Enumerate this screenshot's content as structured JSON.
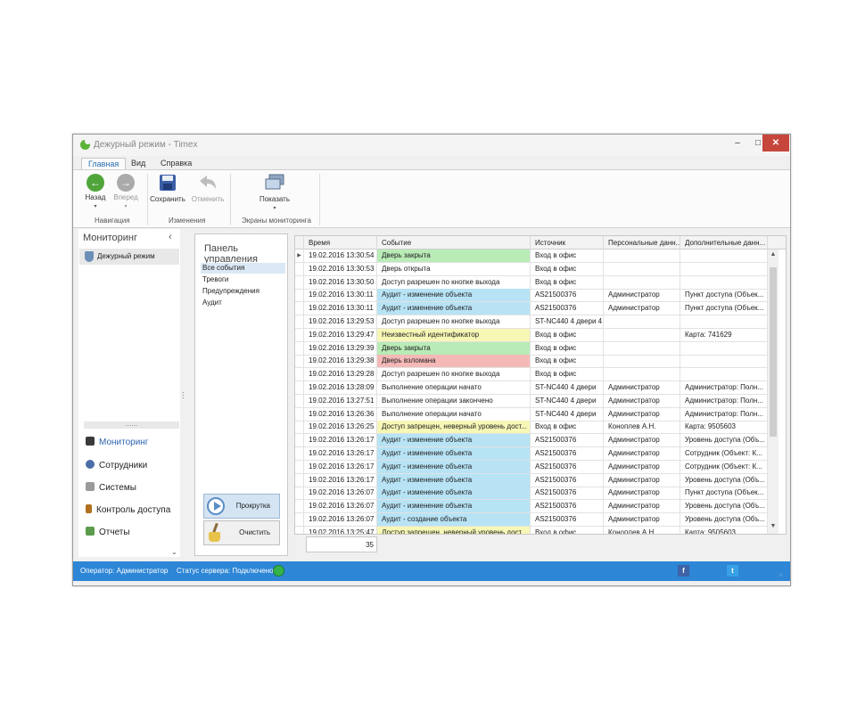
{
  "window": {
    "title": "Дежурный режим - Timex"
  },
  "menu": {
    "items": [
      "Главная",
      "Вид",
      "Справка"
    ]
  },
  "ribbon": {
    "back": "Назад",
    "forward": "Вперед",
    "save": "Сохранить",
    "undo": "Отменить",
    "show": "Показать",
    "groups": {
      "navigation": "Навигация",
      "changes": "Изменения",
      "screens": "Экраны мониторинга"
    }
  },
  "left_panel": {
    "title": "Мониторинг",
    "selected_item": "Дежурный режим",
    "nav": [
      {
        "label": "Мониторинг",
        "icon": "monitor-icon",
        "color": "#3a3a3a"
      },
      {
        "label": "Сотрудники",
        "icon": "employees-icon",
        "color": "#4a6ea8"
      },
      {
        "label": "Системы",
        "icon": "systems-icon",
        "color": "#9a9a9a"
      },
      {
        "label": "Контроль доступа",
        "icon": "door-icon",
        "color": "#b0701f"
      },
      {
        "label": "Отчеты",
        "icon": "reports-icon",
        "color": "#5c9b4c"
      }
    ]
  },
  "control_panel": {
    "title": "Панель управления",
    "items": [
      "Все события",
      "Тревоги",
      "Предупреждения",
      "Аудит"
    ],
    "scroll_button": "Прокрутка",
    "clear_button": "Очистить"
  },
  "grid": {
    "columns": [
      "Время",
      "Событие",
      "Источник",
      "Персональные данн...",
      "Дополнительные данн..."
    ],
    "rows": [
      {
        "time": "19.02.2016 13:30:54",
        "event": "Дверь закрыта",
        "source": "Вход в офис",
        "personal": "",
        "extra": "",
        "color": "#b9ebb7"
      },
      {
        "time": "19.02.2016 13:30:53",
        "event": "Дверь открыта",
        "source": "Вход в офис",
        "personal": "",
        "extra": "",
        "color": ""
      },
      {
        "time": "19.02.2016 13:30:50",
        "event": "Доступ разрешен по кнопке выхода",
        "source": "Вход в офис",
        "personal": "",
        "extra": "",
        "color": ""
      },
      {
        "time": "19.02.2016 13:30:11",
        "event": "Аудит - изменение объекта",
        "source": "AS21500376",
        "personal": "Администратор",
        "extra": "Пункт доступа (Объек...",
        "color": "#b7e3f5"
      },
      {
        "time": "19.02.2016 13:30:11",
        "event": "Аудит - изменение объекта",
        "source": "AS21500376",
        "personal": "Администратор",
        "extra": "Пункт доступа (Объек...",
        "color": "#b7e3f5"
      },
      {
        "time": "19.02.2016 13:29:53",
        "event": "Доступ разрешен по кнопке выхода",
        "source": "ST-NC440 4 двери 4",
        "personal": "",
        "extra": "",
        "color": ""
      },
      {
        "time": "19.02.2016 13:29:47",
        "event": "Неизвестный идентификатор",
        "source": "Вход в офис",
        "personal": "",
        "extra": "Карта: 741629",
        "color": "#f7f7b6"
      },
      {
        "time": "19.02.2016 13:29:39",
        "event": "Дверь закрыта",
        "source": "Вход в офис",
        "personal": "",
        "extra": "",
        "color": "#b9ebb7"
      },
      {
        "time": "19.02.2016 13:29:38",
        "event": "Дверь взломана",
        "source": "Вход в офис",
        "personal": "",
        "extra": "",
        "color": "#f4b9b7"
      },
      {
        "time": "19.02.2016 13:29:28",
        "event": "Доступ разрешен по кнопке выхода",
        "source": "Вход в офис",
        "personal": "",
        "extra": "",
        "color": ""
      },
      {
        "time": "19.02.2016 13:28:09",
        "event": "Выполнение операции начато",
        "source": "ST-NC440 4 двери",
        "personal": "Администратор",
        "extra": "Администратор: Полн...",
        "color": ""
      },
      {
        "time": "19.02.2016 13:27:51",
        "event": "Выполнение операции закончено",
        "source": "ST-NC440 4 двери",
        "personal": "Администратор",
        "extra": "Администратор: Полн...",
        "color": ""
      },
      {
        "time": "19.02.2016 13:26:36",
        "event": "Выполнение операции начато",
        "source": "ST-NC440 4 двери",
        "personal": "Администратор",
        "extra": "Администратор: Полн...",
        "color": ""
      },
      {
        "time": "19.02.2016 13:26:25",
        "event": "Доступ запрещен, неверный уровень дост...",
        "source": "Вход в офис",
        "personal": "Коноплев А.Н.",
        "extra": "Карта: 9505603",
        "color": "#f7f7b6"
      },
      {
        "time": "19.02.2016 13:26:17",
        "event": "Аудит - изменение объекта",
        "source": "AS21500376",
        "personal": "Администратор",
        "extra": "Уровень доступа (Объ...",
        "color": "#b7e3f5"
      },
      {
        "time": "19.02.2016 13:26:17",
        "event": "Аудит - изменение объекта",
        "source": "AS21500376",
        "personal": "Администратор",
        "extra": "Сотрудник (Объект: К...",
        "color": "#b7e3f5"
      },
      {
        "time": "19.02.2016 13:26:17",
        "event": "Аудит - изменение объекта",
        "source": "AS21500376",
        "personal": "Администратор",
        "extra": "Сотрудник (Объект: К...",
        "color": "#b7e3f5"
      },
      {
        "time": "19.02.2016 13:26:17",
        "event": "Аудит - изменение объекта",
        "source": "AS21500376",
        "personal": "Администратор",
        "extra": "Уровень доступа (Объ...",
        "color": "#b7e3f5"
      },
      {
        "time": "19.02.2016 13:26:07",
        "event": "Аудит - изменение объекта",
        "source": "AS21500376",
        "personal": "Администратор",
        "extra": "Пункт доступа (Объек...",
        "color": "#b7e3f5"
      },
      {
        "time": "19.02.2016 13:26:07",
        "event": "Аудит - изменение объекта",
        "source": "AS21500376",
        "personal": "Администратор",
        "extra": "Уровень доступа (Объ...",
        "color": "#b7e3f5"
      },
      {
        "time": "19.02.2016 13:26:07",
        "event": "Аудит - создание объекта",
        "source": "AS21500376",
        "personal": "Администратор",
        "extra": "Уровень доступа (Объ...",
        "color": "#b7e3f5"
      },
      {
        "time": "19.02.2016 13:25:47",
        "event": "Доступ запрещен, неверный уровень дост...",
        "source": "Вход в офис",
        "personal": "Коноплев А.Н.",
        "extra": "Карта: 9505603",
        "color": "#f7f7b6"
      }
    ],
    "count": "35"
  },
  "statusbar": {
    "operator": "Оператор: Администратор",
    "server_status": "Статус сервера: Подключено",
    "facebook": "f",
    "twitter": "t"
  }
}
